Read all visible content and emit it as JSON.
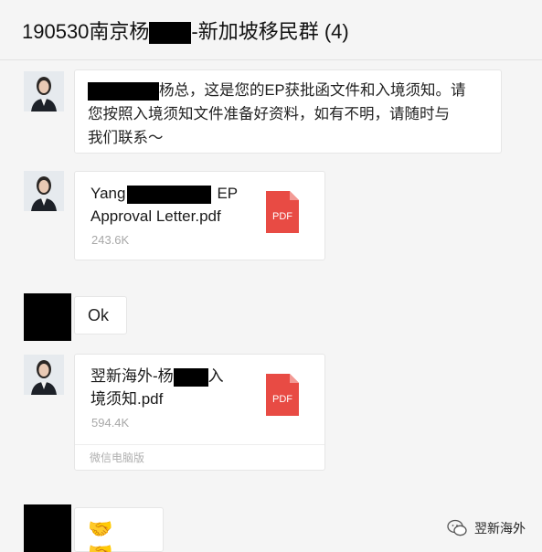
{
  "window": {
    "title_prefix": "190530南京杨",
    "title_suffix": "-新加坡移民群 (4)"
  },
  "messages": [
    {
      "type": "text",
      "sender": "agent",
      "line1_after_redaction": "杨总，这是您的EP获批函文件和入境须知。请",
      "line2": "您按照入境须知文件准备好资料，如有不明，请随时与",
      "line3": "我们联系～"
    },
    {
      "type": "file",
      "sender": "agent",
      "name_line1_prefix": "Yang",
      "name_line1_suffix": "EP",
      "name_line2": "Approval Letter.pdf",
      "size": "243.6K",
      "icon_label": "PDF"
    },
    {
      "type": "text",
      "sender": "user",
      "text": "Ok"
    },
    {
      "type": "file",
      "sender": "agent",
      "name_line1_prefix": "翌新海外-杨",
      "name_line1_suffix": "入",
      "name_line2": "境须知.pdf",
      "size": "594.4K",
      "icon_label": "PDF",
      "footer": "微信电脑版"
    },
    {
      "type": "emoji",
      "sender": "user",
      "text": "🤝 🤝"
    }
  ],
  "watermark": {
    "text": "翌新海外"
  },
  "colors": {
    "background": "#f5f5f5",
    "bubble": "#ffffff",
    "pdf_red": "#e84b44",
    "redaction": "#000000"
  }
}
